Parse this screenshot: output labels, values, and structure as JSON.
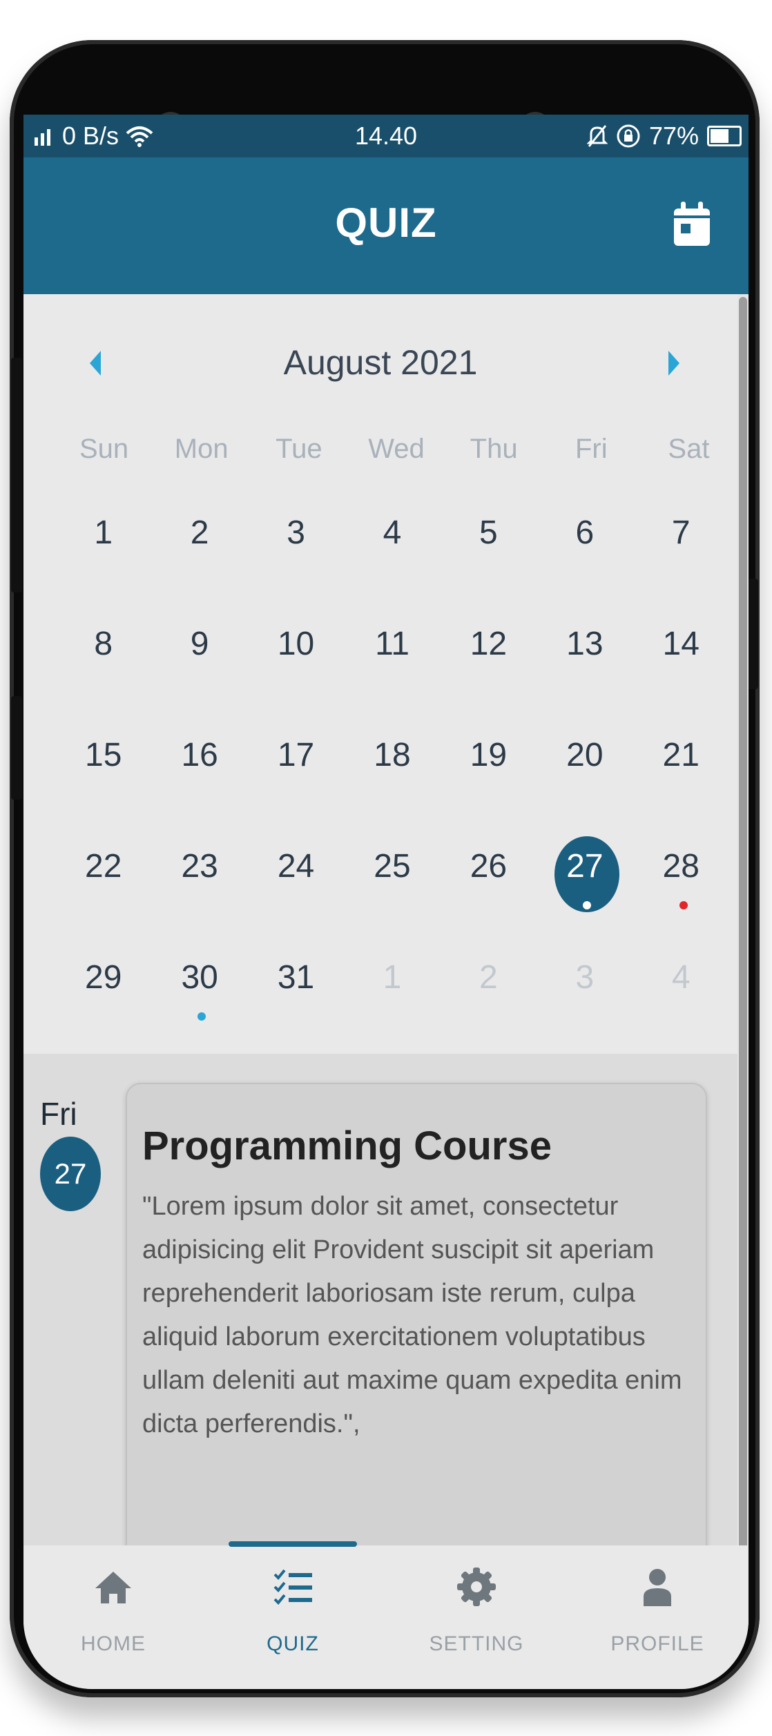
{
  "statusbar": {
    "network": "0 B/s",
    "time": "14.40",
    "battery": "77%",
    "battery_level": 0.77
  },
  "appbar": {
    "title": "QUIZ",
    "calendar_icon": "calendar-icon"
  },
  "calendar": {
    "month_title": "August 2021",
    "weekdays": [
      "Sun",
      "Mon",
      "Tue",
      "Wed",
      "Thu",
      "Fri",
      "Sat"
    ],
    "weeks": [
      [
        "1",
        "2",
        "3",
        "4",
        "5",
        "6",
        "7"
      ],
      [
        "8",
        "9",
        "10",
        "11",
        "12",
        "13",
        "14"
      ],
      [
        "15",
        "16",
        "17",
        "18",
        "19",
        "20",
        "21"
      ],
      [
        "22",
        "23",
        "24",
        "25",
        "26",
        "27",
        "28"
      ],
      [
        "29",
        "30",
        "31",
        "1",
        "2",
        "3",
        "4"
      ]
    ],
    "selected_day": "27",
    "event_dot_colors": {
      "selected": "#ffffff",
      "day_28": "#e0262b",
      "day_30": "#2aa5d6"
    }
  },
  "agenda": {
    "day_name": "Fri",
    "day_number": "27",
    "card_title": "Programming Course",
    "card_body": "\"Lorem ipsum dolor sit amet, consectetur adipisicing elit Provident suscipit sit aperiam reprehenderit laboriosam iste rerum, culpa aliquid laborum exercitationem voluptatibus ullam deleniti aut maxime quam expedita enim dicta perferendis.\","
  },
  "nav": {
    "tabs": [
      {
        "label": "HOME",
        "icon": "home-icon"
      },
      {
        "label": "QUIZ",
        "icon": "checklist-icon"
      },
      {
        "label": "SETTING",
        "icon": "gear-icon"
      },
      {
        "label": "PROFILE",
        "icon": "user-icon"
      }
    ],
    "active_tab": "QUIZ"
  },
  "colors": {
    "appbar": "#1d6a8d",
    "statusbar": "#194f6a",
    "accent": "#2aa5d6",
    "selected_day": "#1a5f80"
  }
}
